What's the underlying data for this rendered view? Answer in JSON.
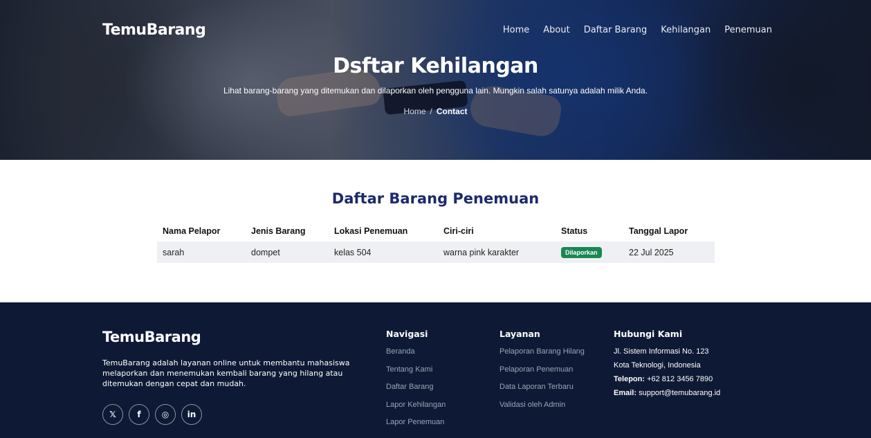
{
  "nav": {
    "brand": "TemuBarang",
    "links": [
      "Home",
      "About",
      "Daftar Barang",
      "Kehilangan",
      "Penemuan"
    ]
  },
  "hero": {
    "title": "Dsftar Kehilangan",
    "subtitle": "Lihat barang-barang yang ditemukan dan dilaporkan oleh pengguna lain. Mungkin salah satunya adalah milik Anda.",
    "breadcrumb": {
      "home": "Home",
      "separator": "/",
      "current": "Contact"
    }
  },
  "section": {
    "title": "Daftar Barang Penemuan",
    "table": {
      "headers": [
        "Nama Pelapor",
        "Jenis Barang",
        "Lokasi Penemuan",
        "Ciri-ciri",
        "Status",
        "Tanggal Lapor"
      ],
      "rows": [
        {
          "nama": "sarah",
          "jenis": "dompet",
          "lokasi": "kelas 504",
          "ciri": "warna pink karakter",
          "status": "Dilaporkan",
          "tanggal": "22 Jul 2025"
        }
      ]
    }
  },
  "footer": {
    "brand": "TemuBarang",
    "description": "TemuBarang adalah layanan online untuk membantu mahasiswa melaporkan dan menemukan kembali barang yang hilang atau ditemukan dengan cepat dan mudah.",
    "socials": [
      {
        "icon": "x-twitter-icon",
        "glyph": "𝕏"
      },
      {
        "icon": "facebook-icon",
        "glyph": "f"
      },
      {
        "icon": "instagram-icon",
        "glyph": "◎"
      },
      {
        "icon": "linkedin-icon",
        "glyph": "in"
      }
    ],
    "navigasi": {
      "title": "Navigasi",
      "items": [
        "Beranda",
        "Tentang Kami",
        "Daftar Barang",
        "Lapor Kehilangan",
        "Lapor Penemuan"
      ]
    },
    "layanan": {
      "title": "Layanan",
      "items": [
        "Pelaporan Barang Hilang",
        "Pelaporan Penemuan",
        "Data Laporan Terbaru",
        "Validasi oleh Admin"
      ]
    },
    "kontak": {
      "title": "Hubungi Kami",
      "address1": "Jl. Sistem Informasi No. 123",
      "address2": "Kota Teknologi, Indonesia",
      "phone_label": "Telepon:",
      "phone": "+62 812 3456 7890",
      "email_label": "Email:",
      "email": "support@temubarang.id"
    }
  },
  "colors": {
    "section_title": "#1c2a6b",
    "status_badge": "#198754",
    "footer_bg": "#0e1a35"
  }
}
